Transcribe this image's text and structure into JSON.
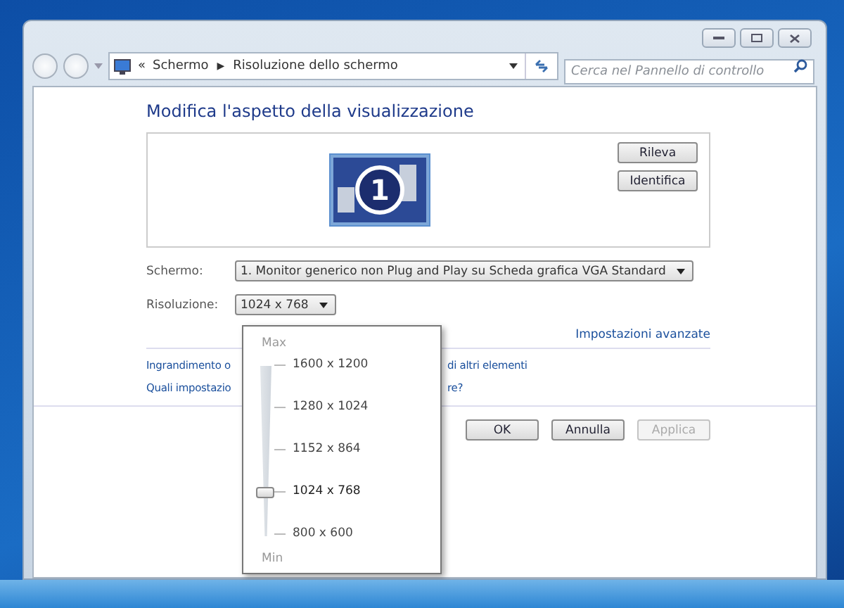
{
  "address_bar": {
    "chevron": "«",
    "separator": "▶",
    "crumbs": [
      "Schermo",
      "Risoluzione dello schermo"
    ]
  },
  "search": {
    "placeholder": "Cerca nel Pannello di controllo"
  },
  "heading": "Modifica l'aspetto della visualizzazione",
  "monitor": {
    "number": "1"
  },
  "side_buttons": [
    "Rileva",
    "Identifica"
  ],
  "fields": [
    {
      "label": "Schermo:",
      "value": "1. Monitor generico non Plug and Play su Scheda grafica VGA Standard"
    },
    {
      "label": "Risoluzione:",
      "value": "1024 x 768"
    }
  ],
  "advanced_link": "Impostazioni avanzate",
  "links": [
    {
      "visible_start": "Ingrandimento o",
      "visible_end": "di altri elementi"
    },
    {
      "visible_start": "Quali impostazio",
      "visible_end": "re?"
    }
  ],
  "buttons": [
    {
      "label": "OK",
      "disabled": false
    },
    {
      "label": "Annulla",
      "disabled": false
    },
    {
      "label": "Applica",
      "disabled": true
    }
  ],
  "resolution_popup": {
    "max_label": "Max",
    "min_label": "Min",
    "level": 0.25,
    "options": [
      {
        "label": "1600 x 1200",
        "selected": false
      },
      {
        "label": "1280 x 1024",
        "selected": false
      },
      {
        "label": "1152 x 864",
        "selected": false
      },
      {
        "label": "1024 x 768",
        "selected": true
      },
      {
        "label": "800 x 600",
        "selected": false
      }
    ]
  }
}
